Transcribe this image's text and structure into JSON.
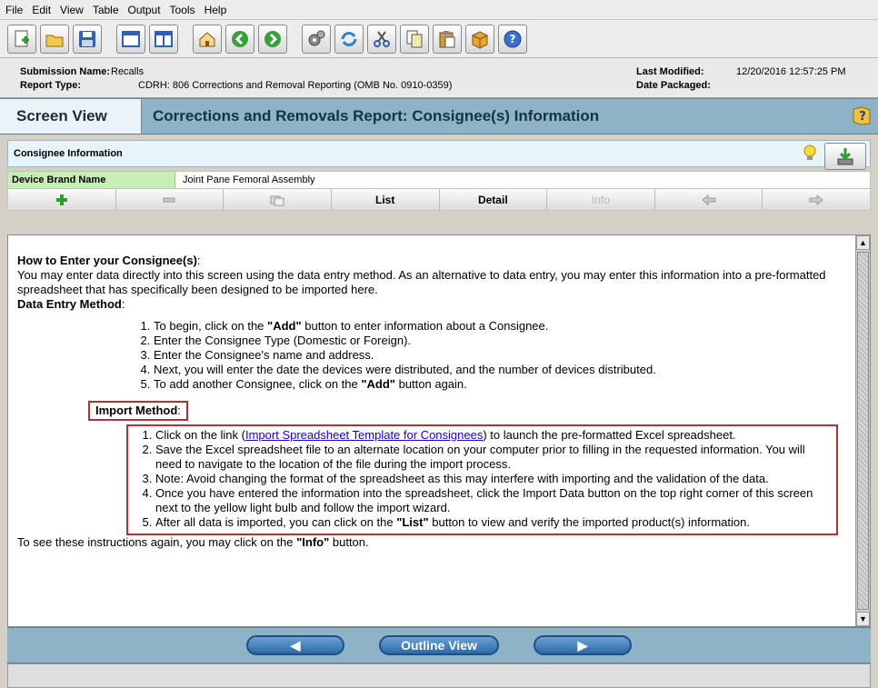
{
  "menu": {
    "items": [
      {
        "label": "File"
      },
      {
        "label": "Edit"
      },
      {
        "label": "View"
      },
      {
        "label": "Table"
      },
      {
        "label": "Output"
      },
      {
        "label": "Tools"
      },
      {
        "label": "Help"
      }
    ]
  },
  "toolbar": {
    "icons": [
      "new-doc-icon",
      "open-folder-icon",
      "save-icon",
      "window-icon",
      "split-window-icon",
      "home-icon",
      "back-icon",
      "forward-icon",
      "gear-icon",
      "refresh-icon",
      "cut-icon",
      "copy-icon",
      "paste-icon",
      "package-icon",
      "help-icon"
    ]
  },
  "submission": {
    "name_label": "Submission Name:",
    "name_value": "Recalls",
    "type_label": "Report Type:",
    "type_value": "CDRH: 806 Corrections and Removal Reporting (OMB No. 0910-0359)",
    "modified_label": "Last Modified:",
    "modified_value": "12/20/2016 12:57:25 PM",
    "packaged_label": "Date Packaged:",
    "packaged_value": ""
  },
  "screen": {
    "tab_label": "Screen View",
    "title": "Corrections and Removals Report: Consignee(s) Information"
  },
  "consignee": {
    "header": "Consignee Information",
    "brand_label": "Device Brand Name",
    "brand_value": "Joint Pane Femoral Assembly"
  },
  "nav": {
    "list_label": "List",
    "detail_label": "Detail",
    "info_label": "Info"
  },
  "instructions": {
    "how_title": "How to Enter your Consignee(s)",
    "how_colon": ":",
    "intro": "You may enter data directly into this screen using the data entry method. As an alternative to data entry, you may enter this information into a pre-formatted spreadsheet that has specifically been designed to be imported here.",
    "data_entry_title": "Data Entry Method",
    "data_entry_steps": {
      "s1_a": "To begin, click on the ",
      "s1_b": "\"Add\"",
      "s1_c": " button to enter information about a Consignee.",
      "s2": "Enter the Consignee Type (Domestic or Foreign).",
      "s3": "Enter the Consignee's name and address.",
      "s4": "Next, you will enter the date the devices were distributed, and the number of devices distributed.",
      "s5_a": "To add another Consignee, click on the ",
      "s5_b": "\"Add\"",
      "s5_c": " button again."
    },
    "import_title": "Import Method",
    "import_steps": {
      "s1_a": "Click on the link (",
      "s1_link": "Import Spreadsheet Template for Consignees",
      "s1_c": ") to launch the pre-formatted Excel spreadsheet.",
      "s2": "Save the Excel spreadsheet file to an alternate location on your computer prior to filling in the requested information. You will need to navigate to the location of the file during the import process.",
      "s3": "Note: Avoid changing the format of the spreadsheet as this may interfere with importing and the validation of the data.",
      "s4": "Once you have entered the information into the spreadsheet, click the Import Data button on the top right corner of this screen next to the yellow light bulb and follow the import wizard.",
      "s5_a": "After all data is imported, you can click on the ",
      "s5_b": "\"List\"",
      "s5_c": " button to view and verify the imported product(s) information."
    },
    "footer_a": "To see these instructions again, you may click on the ",
    "footer_b": "\"Info\"",
    "footer_c": " button."
  },
  "bottom": {
    "outline_label": "Outline View"
  }
}
